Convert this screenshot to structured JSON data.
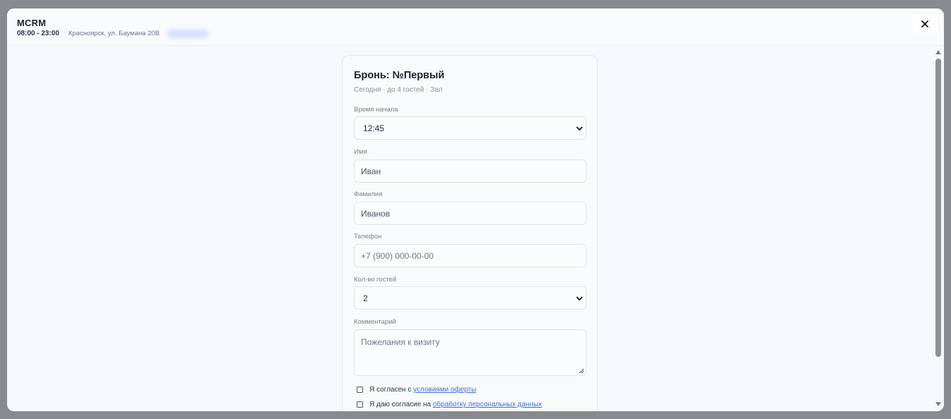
{
  "header": {
    "brand": "MCRM",
    "hours": "08:00 - 23:00",
    "separator": "·",
    "address": "Красноярск, ул. Баумана 20В"
  },
  "icons": {
    "close": "close-icon",
    "chevron": "chevron-down-icon",
    "resize": "resize-grip-icon"
  },
  "booking": {
    "title": "Бронь: №Первый",
    "subtitle": "Сегодня · до 4 гостей · Зал",
    "start_time_label": "Время начала",
    "start_time_value": "12:45",
    "first_name_label": "Имя",
    "first_name_value": "Иван",
    "last_name_label": "Фамилия",
    "last_name_value": "Иванов",
    "phone_label": "Телефон",
    "phone_placeholder": "+7 (900) 000-00-00",
    "guests_label": "Кол-во гостей",
    "guests_value": "2",
    "comment_label": "Комментарий",
    "comment_placeholder": "Пожелания к визиту",
    "consent_offer_text": "Я согласен с ",
    "consent_offer_link": "условиями оферты",
    "consent_pd_text": "Я даю согласие на ",
    "consent_pd_link": "обработку персональных данных"
  }
}
